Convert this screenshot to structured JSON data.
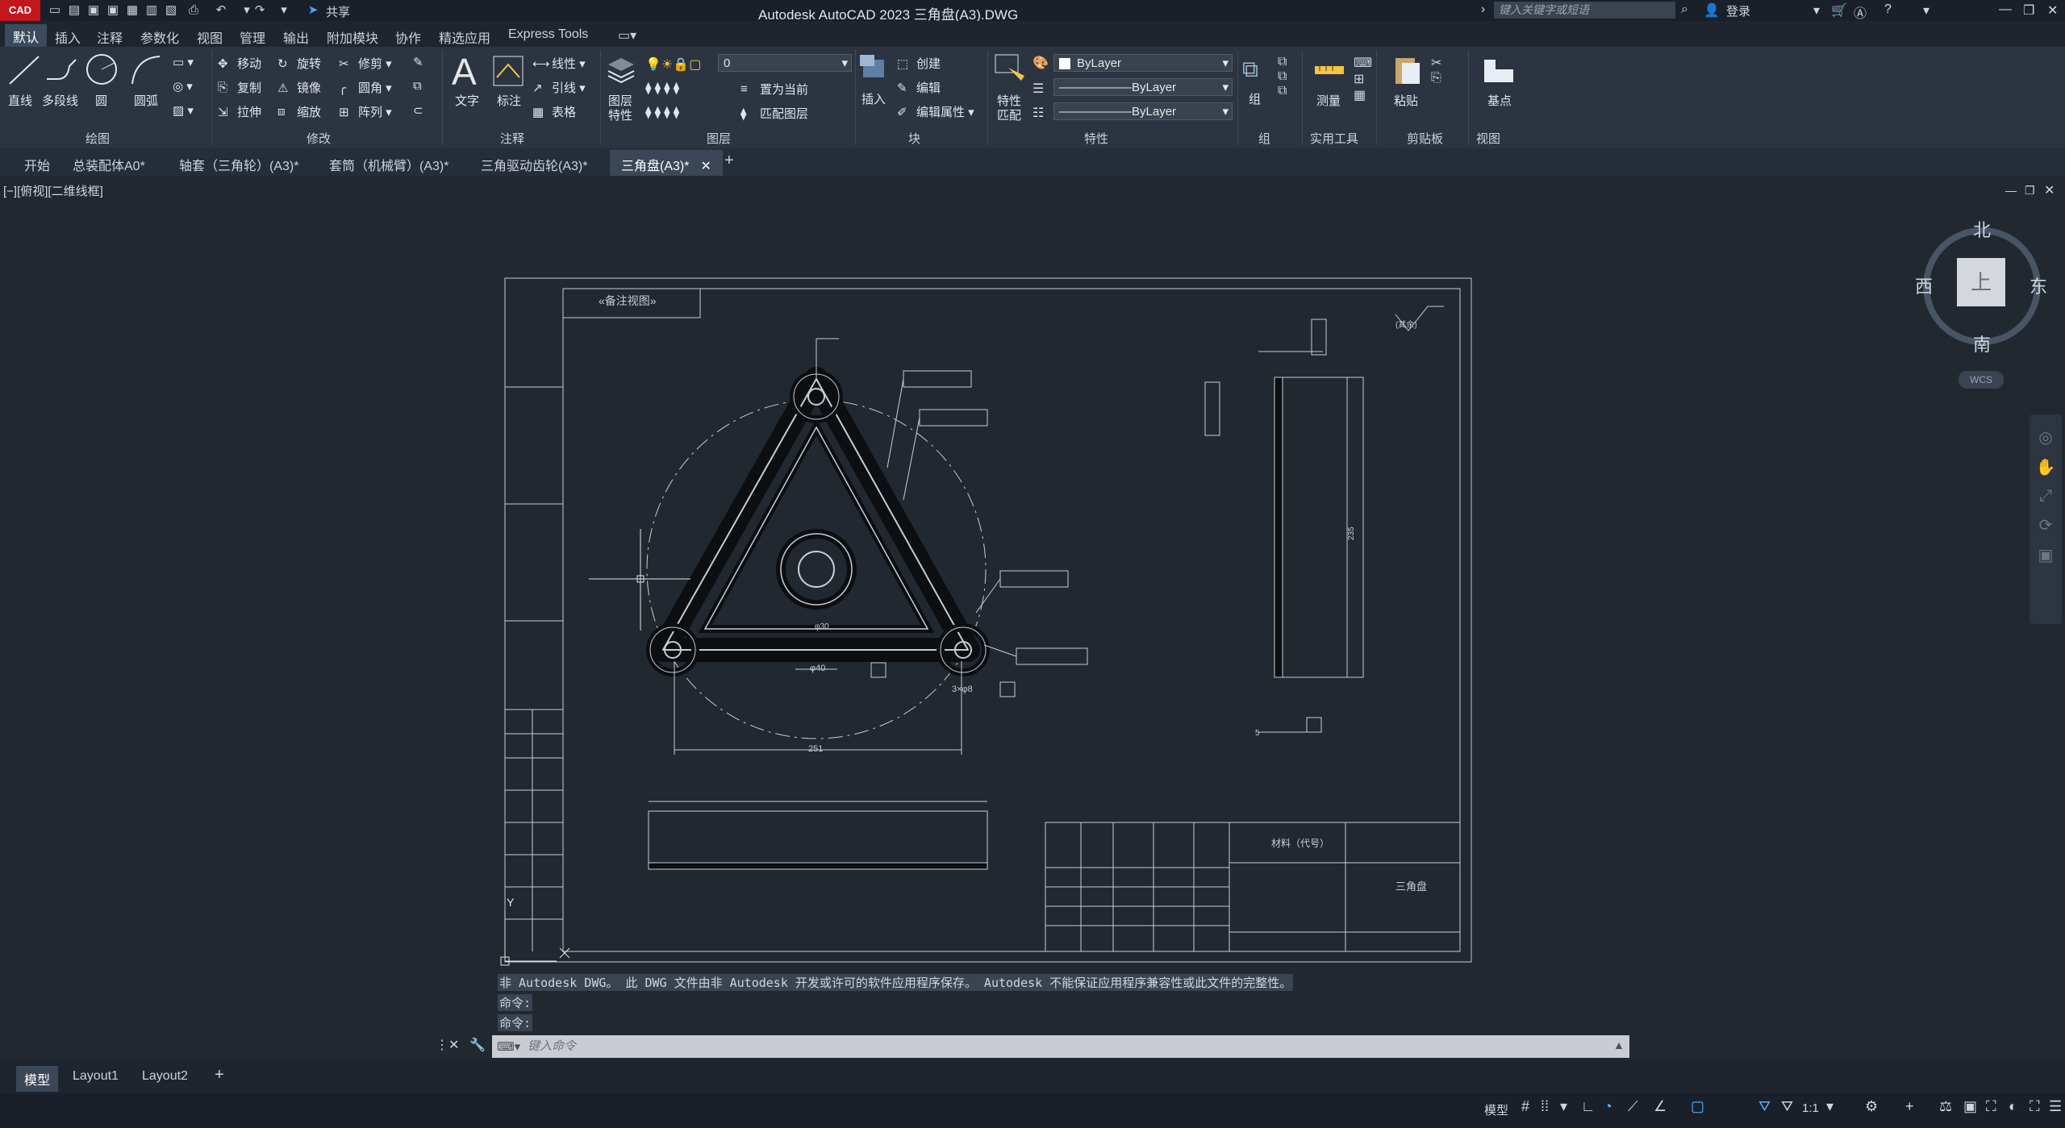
{
  "app": {
    "logo": "CAD",
    "title": "Autodesk AutoCAD 2023    三角盘(A3).DWG",
    "share": "共享",
    "search_placeholder": "键入关键字或短语",
    "login": "登录"
  },
  "ribbon_tabs": [
    "默认",
    "插入",
    "注释",
    "参数化",
    "视图",
    "管理",
    "输出",
    "附加模块",
    "协作",
    "精选应用",
    "Express Tools"
  ],
  "ribbon": {
    "draw": {
      "line": "直线",
      "polyline": "多段线",
      "circle": "圆",
      "arc": "圆弧",
      "panel": "绘图"
    },
    "modify": {
      "move": "移动",
      "rotate": "旋转",
      "trim": "修剪",
      "copy": "复制",
      "mirror": "镜像",
      "fillet": "圆角",
      "stretch": "拉伸",
      "scale": "缩放",
      "array": "阵列",
      "panel": "修改"
    },
    "annotation": {
      "text": "文字",
      "dim": "标注",
      "linear": "线性",
      "leader": "引线",
      "table": "表格",
      "panel": "注释"
    },
    "layers": {
      "layer_props": "图层",
      "layer_props2": "特性",
      "current_layer": "0",
      "set_current": "置为当前",
      "match_layer": "匹配图层",
      "panel": "图层"
    },
    "block": {
      "insert": "插入",
      "create": "创建",
      "edit": "编辑",
      "edit_attr": "编辑属性",
      "panel": "块"
    },
    "properties": {
      "match": "特性",
      "match2": "匹配",
      "color": "ByLayer",
      "linetype": "ByLayer",
      "lineweight": "ByLayer",
      "panel": "特性"
    },
    "groups": {
      "group": "组",
      "panel": "组"
    },
    "utilities": {
      "measure": "测量",
      "panel": "实用工具"
    },
    "clipboard": {
      "paste": "粘贴",
      "panel": "剪贴板"
    },
    "view": {
      "base": "基点",
      "panel": "视图"
    }
  },
  "doc_tabs": [
    "开始",
    "总装配体A0*",
    "轴套（三角轮）(A3)*",
    "套筒（机械臂）(A3)*",
    "三角驱动齿轮(A3)*",
    "三角盘(A3)*"
  ],
  "view_label": "[−][俯视][二维线框]",
  "viewcube": {
    "north": "北",
    "south": "南",
    "east": "东",
    "west": "西",
    "top": "上",
    "wcs": "WCS"
  },
  "drawing": {
    "sheet_label": "«备注视图»",
    "dim_251": "251",
    "dim_40": "φ40",
    "dim_3x8": "3×φ8",
    "dim_30": "φ30",
    "dim_235": "235",
    "dim_5": "5",
    "title_cell": "三角盘",
    "material": "材料（代号）",
    "surface": "(其余)"
  },
  "command": {
    "history": [
      "非 Autodesk DWG。 此 DWG 文件由非 Autodesk 开发或许可的软件应用程序保存。 Autodesk 不能保证应用程序兼容性或此文件的完整性。",
      "命令:",
      "命令:"
    ],
    "placeholder": "键入命令"
  },
  "layout_tabs": [
    "模型",
    "Layout1",
    "Layout2"
  ],
  "status": {
    "model": "模型",
    "scale": "1:1"
  }
}
